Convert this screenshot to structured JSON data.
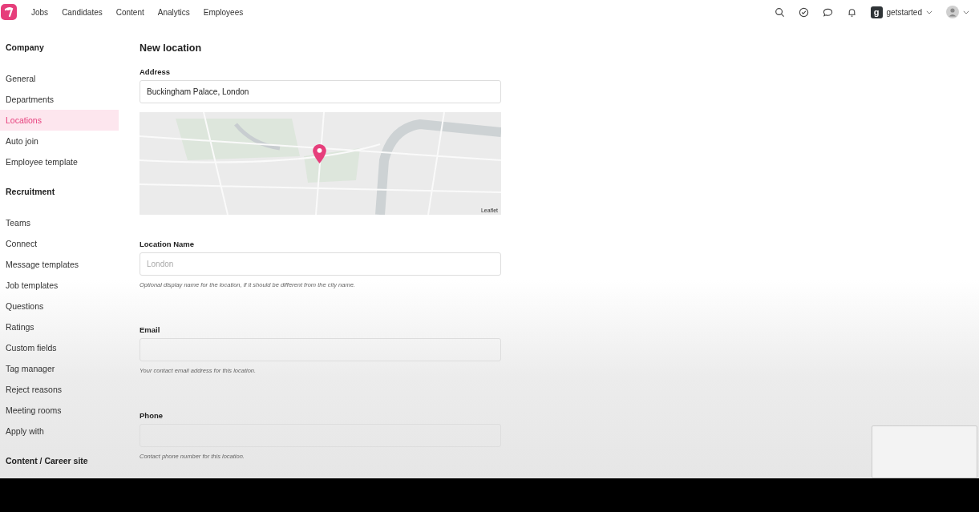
{
  "nav": {
    "items": [
      "Jobs",
      "Candidates",
      "Content",
      "Analytics",
      "Employees"
    ],
    "account": {
      "initial": "g",
      "name": "getstarted"
    }
  },
  "sidebar": {
    "sections": [
      {
        "title": "Company",
        "items": [
          {
            "label": "General",
            "selected": false
          },
          {
            "label": "Departments",
            "selected": false
          },
          {
            "label": "Locations",
            "selected": true
          },
          {
            "label": "Auto join",
            "selected": false
          },
          {
            "label": "Employee template",
            "selected": false
          }
        ]
      },
      {
        "title": "Recruitment",
        "items": [
          {
            "label": "Teams",
            "selected": false
          },
          {
            "label": "Connect",
            "selected": false
          },
          {
            "label": "Message templates",
            "selected": false
          },
          {
            "label": "Job templates",
            "selected": false
          },
          {
            "label": "Questions",
            "selected": false
          },
          {
            "label": "Ratings",
            "selected": false
          },
          {
            "label": "Custom fields",
            "selected": false
          },
          {
            "label": "Tag manager",
            "selected": false
          },
          {
            "label": "Reject reasons",
            "selected": false
          },
          {
            "label": "Meeting rooms",
            "selected": false
          },
          {
            "label": "Apply with",
            "selected": false
          }
        ]
      },
      {
        "title": "Content / Career site"
      }
    ]
  },
  "form": {
    "title": "New location",
    "address": {
      "label": "Address",
      "value": "Buckingham Palace, London"
    },
    "map": {
      "attribution": "Leaflet"
    },
    "fields": [
      {
        "label": "Location Name",
        "placeholder": "London",
        "hint": "Optional display name for the location, if it should be different from the city name."
      },
      {
        "label": "Email",
        "hint": "Your contact email address for this location."
      },
      {
        "label": "Phone",
        "hint": "Contact phone number for this location."
      }
    ]
  }
}
